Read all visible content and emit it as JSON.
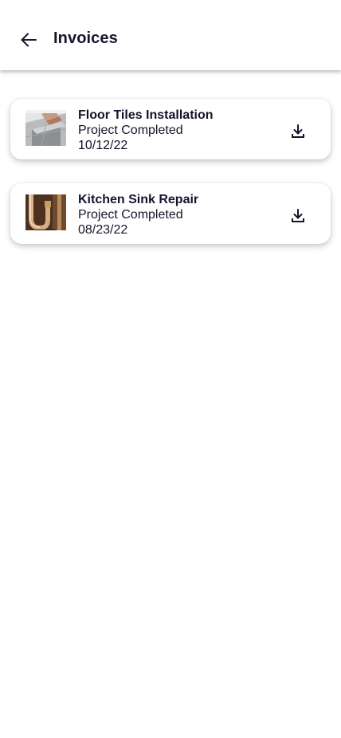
{
  "header": {
    "title": "Invoices",
    "back_icon": "arrow-left-icon"
  },
  "invoices": [
    {
      "title": "Floor Tiles Installation",
      "status": "Project Completed",
      "date": "10/12/22",
      "thumbnail": "floor-tiles-photo",
      "action_icon": "download-icon"
    },
    {
      "title": "Kitchen Sink Repair",
      "status": "Project Completed",
      "date": "08/23/22",
      "thumbnail": "sink-pipe-photo",
      "action_icon": "download-icon"
    }
  ],
  "colors": {
    "text": "#14142b",
    "background": "#ffffff"
  }
}
